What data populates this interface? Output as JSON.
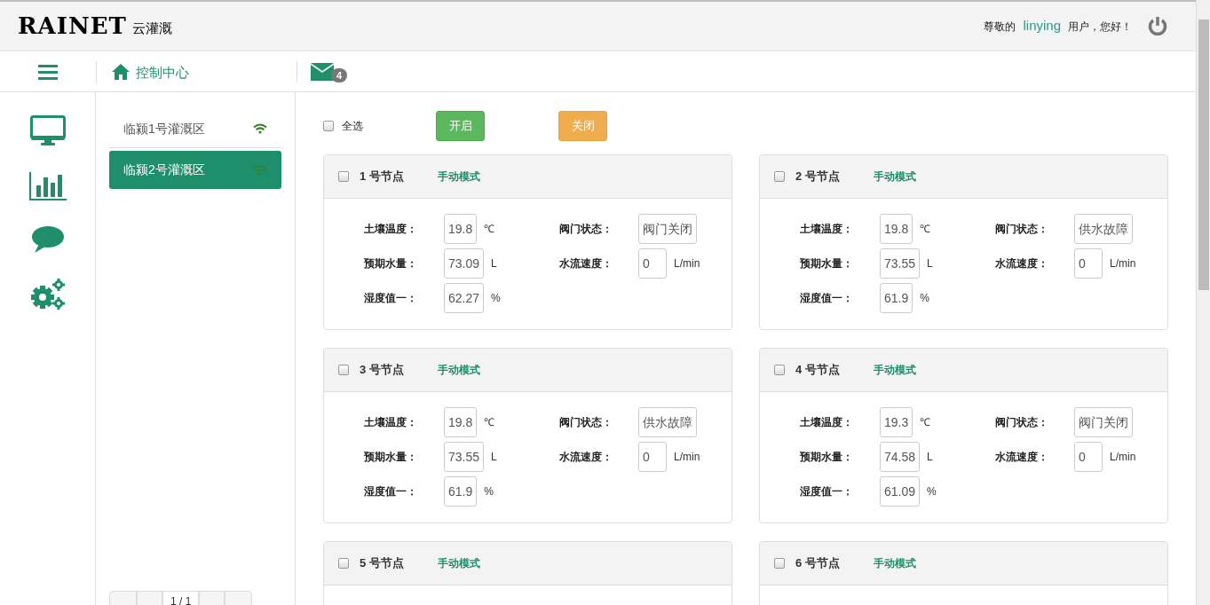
{
  "header": {
    "logo": "RAINET",
    "logo_sub": "云灌溉",
    "greeting_before": "尊敬的",
    "username": "linying",
    "greeting_after": "用户，您好！"
  },
  "toolbar": {
    "breadcrumb": "控制中心",
    "message_count": "4"
  },
  "zones": [
    {
      "name": "临颍1号灌溉区",
      "selected": false
    },
    {
      "name": "临颍2号灌溉区",
      "selected": true
    }
  ],
  "pager": {
    "text": "1 / 1"
  },
  "controls": {
    "select_all": {
      "label": "全选",
      "checked": false
    },
    "open_button": "开启",
    "close_button": "关闭"
  },
  "nodes": [
    {
      "title": "1 号节点",
      "mode": "手动模式",
      "checked": false,
      "left_fields": [
        {
          "label": "土壤温度：",
          "value": "19.8",
          "unit": "℃"
        },
        {
          "label": "预期水量：",
          "value": "73.09",
          "unit": "L"
        },
        {
          "label": "湿度值一：",
          "value": "62.27",
          "unit": "%"
        }
      ],
      "right_fields": [
        {
          "label": "阀门状态：",
          "value": "阀门关闭"
        },
        {
          "label": "水流速度：",
          "value": "0",
          "unit": "L/min"
        }
      ]
    },
    {
      "title": "2 号节点",
      "mode": "手动模式",
      "checked": false,
      "left_fields": [
        {
          "label": "土壤温度：",
          "value": "19.8",
          "unit": "℃"
        },
        {
          "label": "预期水量：",
          "value": "73.55",
          "unit": "L"
        },
        {
          "label": "湿度值一：",
          "value": "61.9",
          "unit": "%"
        }
      ],
      "right_fields": [
        {
          "label": "阀门状态：",
          "value": "供水故障"
        },
        {
          "label": "水流速度：",
          "value": "0",
          "unit": "L/min"
        }
      ]
    },
    {
      "title": "3 号节点",
      "mode": "手动模式",
      "checked": false,
      "left_fields": [
        {
          "label": "土壤温度：",
          "value": "19.8",
          "unit": "℃"
        },
        {
          "label": "预期水量：",
          "value": "73.55",
          "unit": "L"
        },
        {
          "label": "湿度值一：",
          "value": "61.9",
          "unit": "%"
        }
      ],
      "right_fields": [
        {
          "label": "阀门状态：",
          "value": "供水故障"
        },
        {
          "label": "水流速度：",
          "value": "0",
          "unit": "L/min"
        }
      ]
    },
    {
      "title": "4 号节点",
      "mode": "手动模式",
      "checked": false,
      "left_fields": [
        {
          "label": "土壤温度：",
          "value": "19.3",
          "unit": "℃"
        },
        {
          "label": "预期水量：",
          "value": "74.58",
          "unit": "L"
        },
        {
          "label": "湿度值一：",
          "value": "61.09",
          "unit": "%"
        }
      ],
      "right_fields": [
        {
          "label": "阀门状态：",
          "value": "阀门关闭"
        },
        {
          "label": "水流速度：",
          "value": "0",
          "unit": "L/min"
        }
      ]
    },
    {
      "title": "5 号节点",
      "mode": "手动模式",
      "checked": false
    },
    {
      "title": "6 号节点",
      "mode": "手动模式",
      "checked": false
    }
  ]
}
